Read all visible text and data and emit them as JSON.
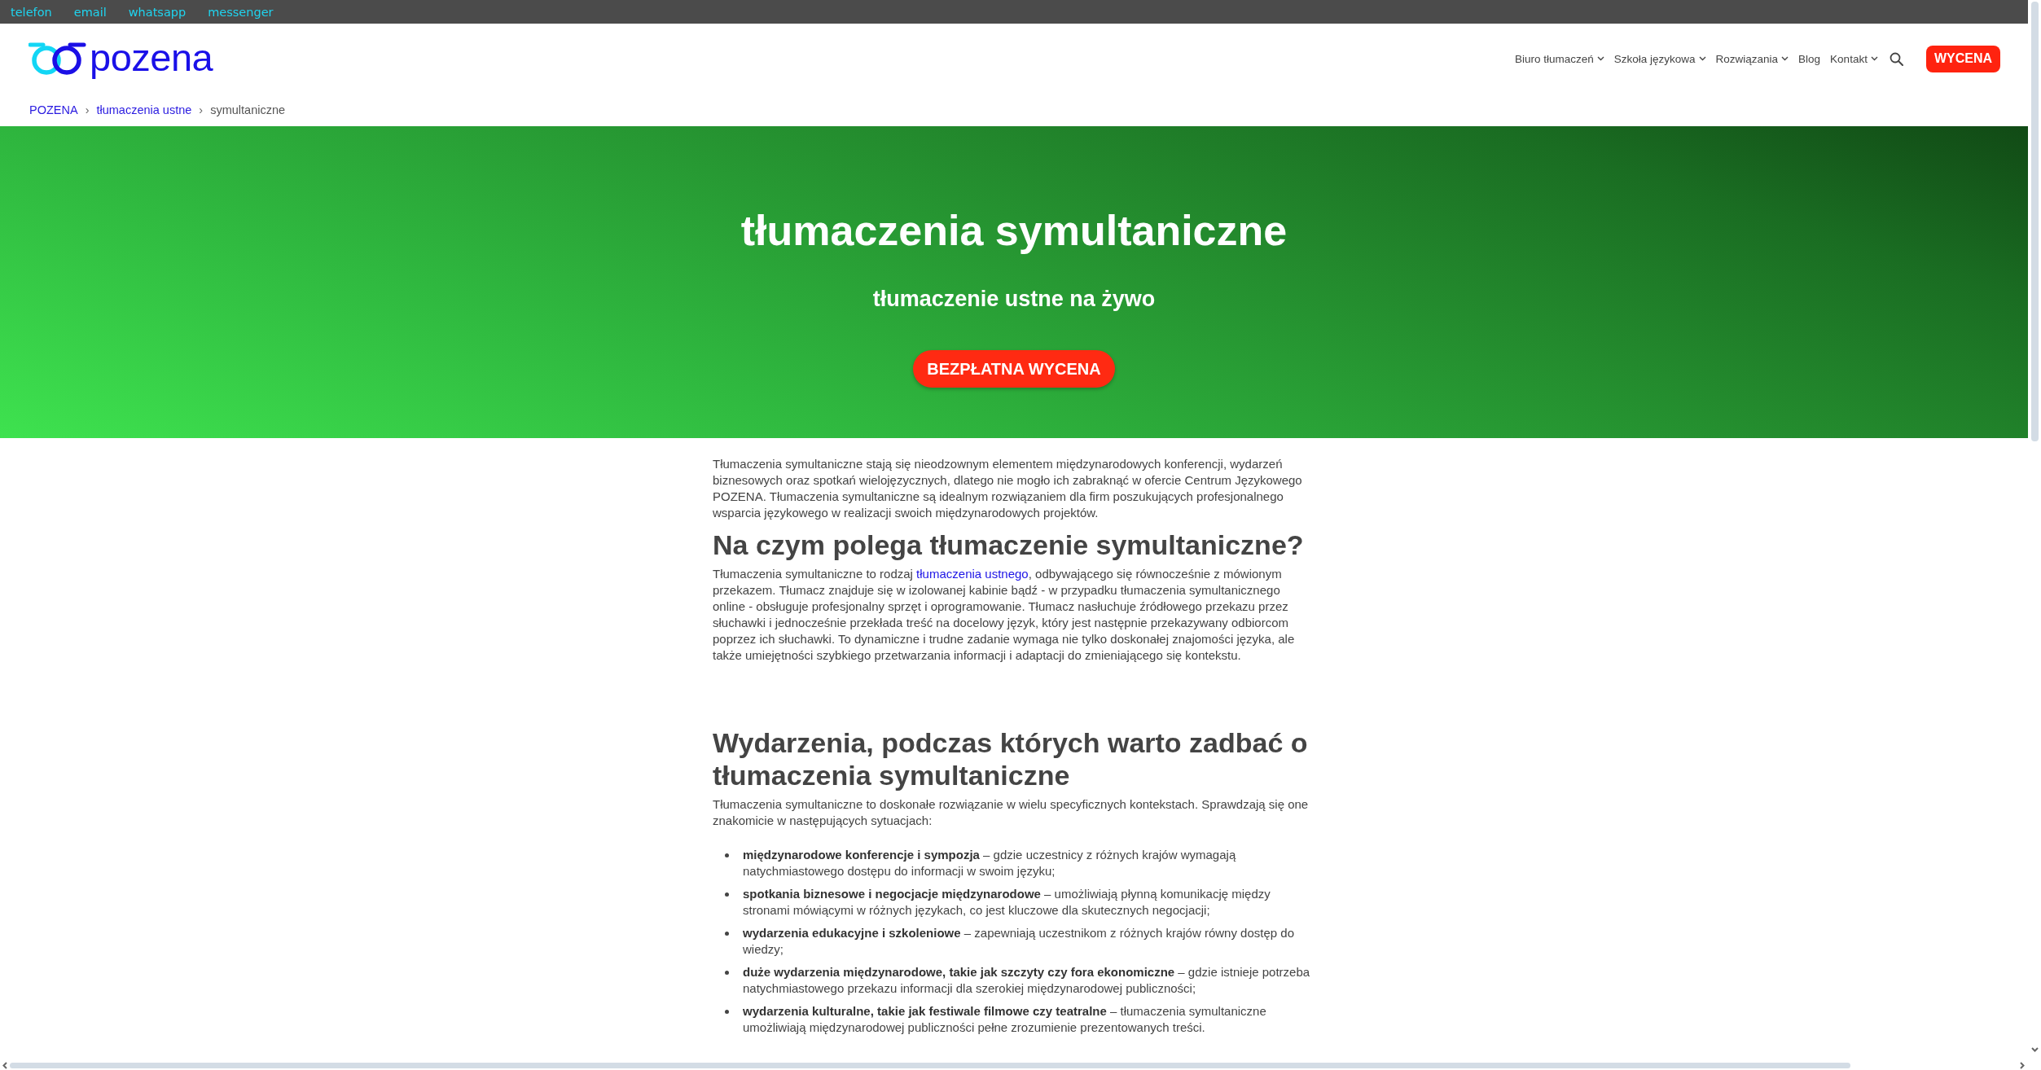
{
  "top_bar": {
    "links": [
      "telefon",
      "email",
      "whatsapp",
      "messenger"
    ]
  },
  "header": {
    "logo": {
      "text": "pozena"
    },
    "nav": [
      {
        "label": "Biuro tłumaczeń",
        "dropdown": true
      },
      {
        "label": "Szkoła językowa",
        "dropdown": true
      },
      {
        "label": "Rozwiązania",
        "dropdown": true
      },
      {
        "label": "Blog",
        "dropdown": false
      },
      {
        "label": "Kontakt",
        "dropdown": true
      }
    ],
    "quote_button": "WYCENA"
  },
  "breadcrumb": [
    {
      "kind": "link",
      "text": "POZENA"
    },
    {
      "kind": "separator",
      "text": "›"
    },
    {
      "kind": "link",
      "text": "tłumaczenia ustne"
    },
    {
      "kind": "separator",
      "text": "›"
    },
    {
      "kind": "current",
      "text": "symultaniczne"
    }
  ],
  "hero": {
    "title": "tłumaczenia symultaniczne",
    "subtitle": "tłumaczenie ustne na żywo",
    "button": "BEZPŁATNA WYCENA"
  },
  "article": [
    {
      "kind": "paragraph",
      "parts": [
        {
          "kind": "text",
          "text": "Tłumaczenia symultaniczne stają się nieodzownym elementem międzynarodowych konferencji, wydarzeń biznesowych oraz spotkań wielojęzycznych, dlatego nie mogło ich zabraknąć w ofercie Centrum Językowego POZENA. Tłumaczenia symultaniczne są idealnym rozwiązaniem dla firm poszukujących profesjonalnego wsparcia językowego w realizacji swoich międzynarodowych projektów."
        }
      ]
    },
    {
      "kind": "heading",
      "text": "Na czym polega tłumaczenie symultaniczne?"
    },
    {
      "kind": "paragraph",
      "parts": [
        {
          "kind": "text",
          "text": "Tłumaczenia symultaniczne to rodzaj "
        },
        {
          "kind": "link",
          "text": "tłumaczenia ustnego"
        },
        {
          "kind": "text",
          "text": ", odbywającego się równocześnie z mówionym przekazem. Tłumacz znajduje się w izolowanej kabinie bądź - w przypadku tłumaczenia symultanicznego online - obsługuje profesjonalny sprzęt i oprogramowanie. Tłumacz nasłuchuje źródłowego przekazu przez słuchawki i jednocześnie przekłada treść na docelowy język, który jest następnie przekazywany odbiorcom poprzez ich słuchawki. To dynamiczne i trudne zadanie wymaga nie tylko doskonałej znajomości języka, ale także umiejętności szybkiego przetwarzania informacji i adaptacji do zmieniającego się kontekstu."
        }
      ]
    },
    {
      "kind": "heading",
      "text": "Wydarzenia, podczas których warto zadbać o tłumaczenia symultaniczne"
    },
    {
      "kind": "paragraph",
      "parts": [
        {
          "kind": "text",
          "text": "Tłumaczenia symultaniczne to doskonałe rozwiązanie w wielu specyficznych kontekstach. Sprawdzają się one znakomicie w następujących sytuacjach:"
        }
      ]
    },
    {
      "kind": "list",
      "items": [
        "**międzynarodowe konferencje i sympozja** – gdzie uczestnicy z różnych krajów wymagają natychmiastowego dostępu do informacji w swoim języku;",
        "**spotkania biznesowe i negocjacje międzynarodowe** – umożliwiają płynną komunikację między stronami mówiącymi w różnych językach, co jest kluczowe dla skutecznych negocjacji;",
        "**wydarzenia edukacyjne i szkoleniowe** – zapewniają uczestnikom z różnych krajów równy dostęp do wiedzy;",
        "**duże wydarzenia międzynarodowe, takie jak szczyty czy fora ekonomiczne** – gdzie istnieje potrzeba natychmiastowego przekazu informacji dla szerokiej międzynarodowej publiczności;",
        "**wydarzenia kulturalne, takie jak festiwale filmowe czy teatralne** – tłumaczenia symultaniczne umożliwiają międzynarodowej publiczności pełne zrozumienie prezentowanych treści."
      ]
    }
  ]
}
